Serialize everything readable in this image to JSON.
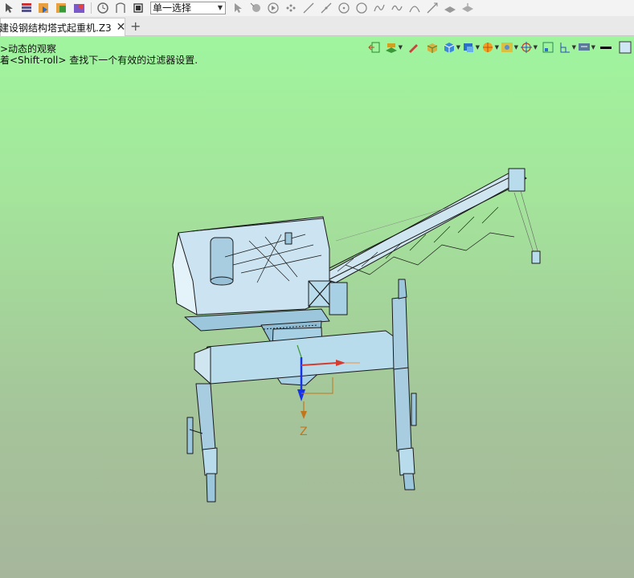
{
  "toolbar": {
    "icons": [
      "arrow-icon",
      "layers-icon",
      "import-icon",
      "export-icon",
      "tools-icon",
      "clock-icon",
      "trim-icon",
      "stop-icon"
    ],
    "filter_select": {
      "value": "单一选择"
    },
    "draw_icons": [
      "pointer-icon",
      "pick-icon",
      "play-icon",
      "dots-icon",
      "line-icon",
      "line2-icon",
      "circle-icon",
      "circle2-icon",
      "curve-icon",
      "wave-icon",
      "arc-icon",
      "slash-icon",
      "surface-icon",
      "surface2-icon"
    ]
  },
  "tabs": [
    {
      "label": "建设钢结构塔式起重机.Z3",
      "active": true
    }
  ],
  "tab_add_label": "+",
  "hints": {
    "line1": ">动态的观察",
    "line2": "着<Shift-roll> 查找下一个有效的过滤器设置."
  },
  "view_tools": [
    "exit-view-icon",
    "layer-view-icon",
    "pen-icon",
    "box-icon",
    "cube-icon",
    "view-cube-icon",
    "sun-icon",
    "render-icon",
    "target-icon",
    "frame-icon",
    "axis-icon",
    "display-icon",
    "line-color-icon",
    "fill-color-icon"
  ],
  "axis": {
    "label": "Z"
  },
  "colors": {
    "background_top": "#a0f59e",
    "background_bottom": "#a6b69b",
    "model_fill": "#b8dcec",
    "axis_z": "#1733e8",
    "axis_x": "#d63b2f",
    "axis_label": "#c2761b"
  }
}
